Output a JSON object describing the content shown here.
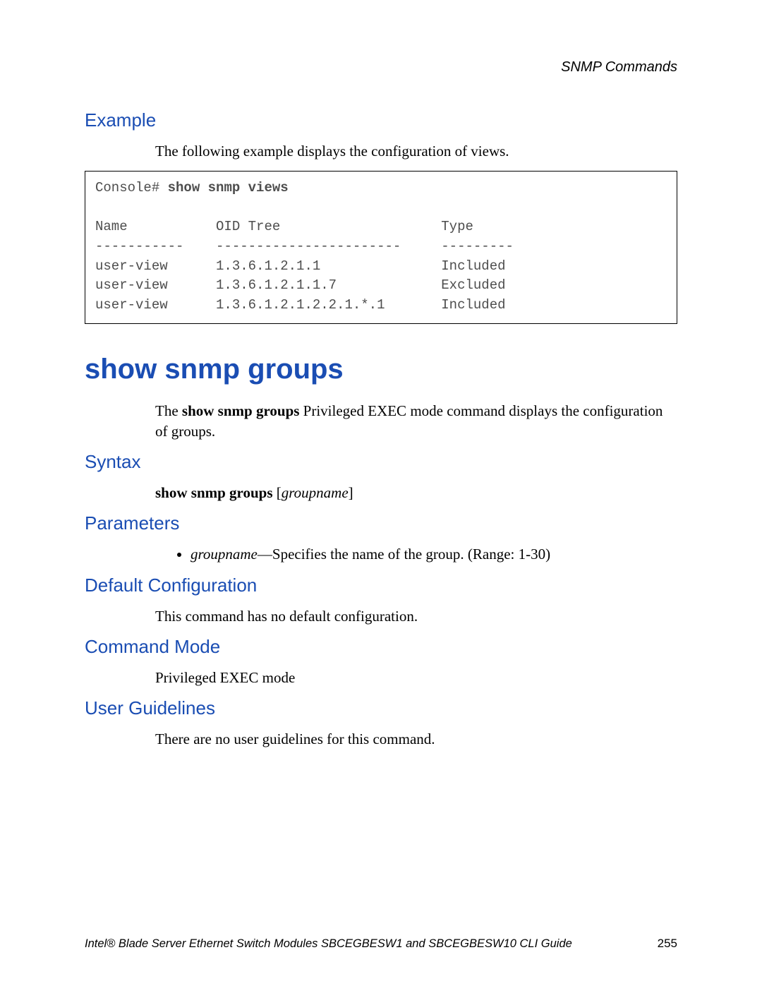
{
  "running_head": "SNMP Commands",
  "example": {
    "heading": "Example",
    "intro": "The following example displays the configuration of views.",
    "console_prompt": "Console# ",
    "console_cmd": "show snmp views",
    "col_name": "Name",
    "col_oid": "OID Tree",
    "col_type": "Type",
    "sep_name": "-----------",
    "sep_oid": "-----------------------",
    "sep_type": "---------",
    "rows": [
      {
        "name": "user-view",
        "oid": "1.3.6.1.2.1.1",
        "type": "Included"
      },
      {
        "name": "user-view",
        "oid": "1.3.6.1.2.1.1.7",
        "type": "Excluded"
      },
      {
        "name": "user-view",
        "oid": "1.3.6.1.2.1.2.2.1.*.1",
        "type": "Included"
      }
    ]
  },
  "command": {
    "title": "show snmp groups",
    "desc_pre": "The ",
    "desc_cmd": "show snmp groups",
    "desc_post": " Privileged EXEC mode command displays the configuration of groups."
  },
  "syntax": {
    "heading": "Syntax",
    "cmd": "show snmp groups",
    "arg": "groupname"
  },
  "parameters": {
    "heading": "Parameters",
    "items": [
      {
        "name": "groupname",
        "desc": "—Specifies the name of the group. (Range: 1-30)"
      }
    ]
  },
  "default_cfg": {
    "heading": "Default Configuration",
    "text": "This command has no default configuration."
  },
  "cmd_mode": {
    "heading": "Command Mode",
    "text": "Privileged EXEC mode"
  },
  "user_guidelines": {
    "heading": "User Guidelines",
    "text": "There are no user guidelines for this command."
  },
  "footer": {
    "title": "Intel® Blade Server Ethernet Switch Modules SBCEGBESW1 and SBCEGBESW10 CLI Guide",
    "page": "255"
  }
}
